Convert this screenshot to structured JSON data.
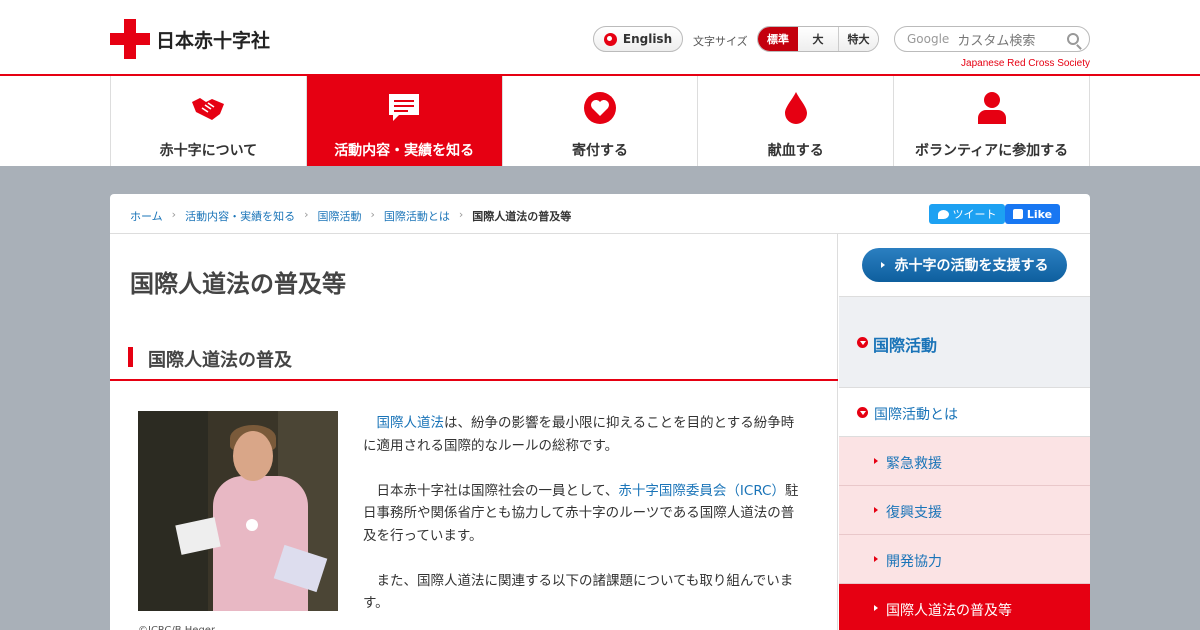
{
  "header": {
    "logo_text": "日本赤十字社",
    "english_label": "English",
    "fontsize_label": "文字サイズ",
    "fontsize_options": [
      "標準",
      "大",
      "特大"
    ],
    "search_google": "Google",
    "search_placeholder": "カスタム検索",
    "tagline": "Japanese Red Cross Society"
  },
  "gnav": [
    {
      "label": "赤十字について",
      "icon": "handshake-icon"
    },
    {
      "label": "活動内容・実績を知る",
      "icon": "speech-bubble-icon"
    },
    {
      "label": "寄付する",
      "icon": "heart-icon"
    },
    {
      "label": "献血する",
      "icon": "blood-drop-icon"
    },
    {
      "label": "ボランティアに参加する",
      "icon": "person-icon"
    }
  ],
  "breadcrumb": {
    "items": [
      "ホーム",
      "活動内容・実績を知る",
      "国際活動",
      "国際活動とは"
    ],
    "current": "国際人道法の普及等"
  },
  "social": {
    "tweet": "ツイート",
    "like": "Like"
  },
  "main": {
    "title": "国際人道法の普及等",
    "section_heading": "国際人道法の普及",
    "photo_caption": "©ICRC/B.Heger",
    "p1_link": "国際人道法",
    "p1_rest": "は、紛争の影響を最小限に抑えることを目的とする紛争時に適用される国際的なルールの総称です。",
    "p2_pre": "日本赤十字社は国際社会の一員として、",
    "p2_link": "赤十字国際委員会（ICRC）",
    "p2_rest": "駐日事務所や関係省庁とも協力して赤十字のルーツである国際人道法の普及を行っています。",
    "p3": "また、国際人道法に関連する以下の諸課題についても取り組んでいます。"
  },
  "side": {
    "support_button": "赤十字の活動を支援する",
    "heading": "国際活動",
    "sub": "国際活動とは",
    "items": [
      "緊急救援",
      "復興支援",
      "開発協力",
      "国際人道法の普及等"
    ]
  }
}
